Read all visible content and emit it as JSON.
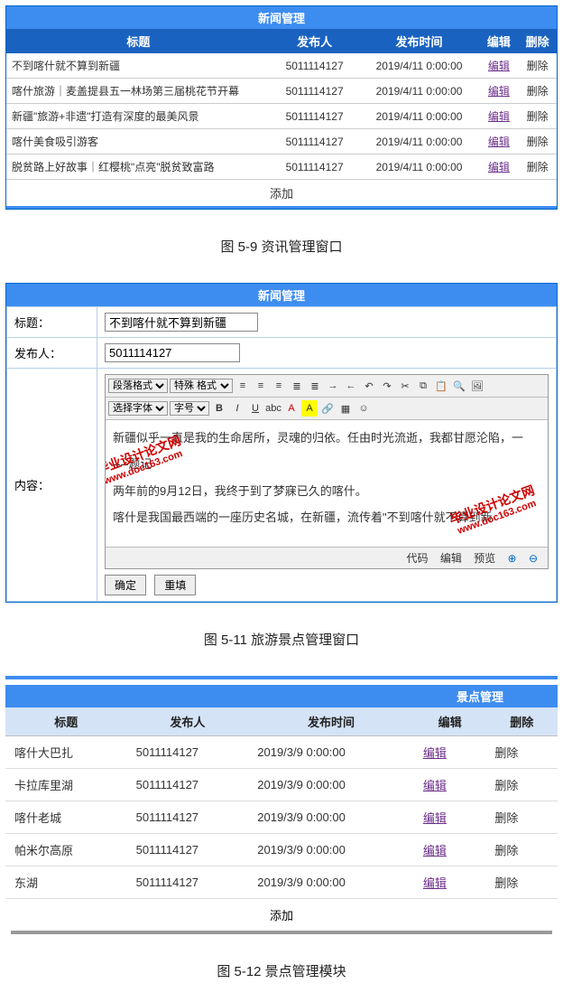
{
  "panel1": {
    "title": "新闻管理",
    "headers": {
      "title": "标题",
      "publisher": "发布人",
      "time": "发布时间",
      "edit": "编辑",
      "del": "删除"
    },
    "rows": [
      {
        "title": "不到喀什就不算到新疆",
        "publisher": "5011114127",
        "time": "2019/4/11 0:00:00",
        "edit": "编辑",
        "del": "删除"
      },
      {
        "title": "喀什旅游｜麦盖提县五一林场第三届桃花节开幕",
        "publisher": "5011114127",
        "time": "2019/4/11 0:00:00",
        "edit": "编辑",
        "del": "删除"
      },
      {
        "title": "新疆\"旅游+非遗\"打造有深度的最美风景",
        "publisher": "5011114127",
        "time": "2019/4/11 0:00:00",
        "edit": "编辑",
        "del": "删除"
      },
      {
        "title": "喀什美食吸引游客",
        "publisher": "5011114127",
        "time": "2019/4/11 0:00:00",
        "edit": "编辑",
        "del": "删除"
      },
      {
        "title": "脱贫路上好故事｜红樱桃\"点亮\"脱贫致富路",
        "publisher": "5011114127",
        "time": "2019/4/11 0:00:00",
        "edit": "编辑",
        "del": "删除"
      }
    ],
    "add": "添加"
  },
  "caption1": "图 5-9 资讯管理窗口",
  "form": {
    "panel_title": "新闻管理",
    "title_label": "标题：",
    "title_value": "不到喀什就不算到新疆",
    "publisher_label": "发布人：",
    "publisher_value": "5011114127",
    "content_label": "内容：",
    "toolbar": {
      "para": "段落格式",
      "special": "特殊     格式",
      "font": "选择字体",
      "size": "字号"
    },
    "body_lines": [
      "新疆似乎一直是我的生命居所，灵魂的归依。任由时光流逝，我都甘愿沦陷，一",
      "----题记",
      "两年前的9月12日，我终于到了梦寐已久的喀什。",
      "喀什是我国最西端的一座历史名城，在新疆，流传着\"不到喀什就不算到新"
    ],
    "footer": {
      "code": "代码",
      "edit": "编辑",
      "preview": "预览"
    },
    "buttons": {
      "ok": "确定",
      "reset": "重填"
    },
    "watermark": {
      "big": "毕业设计论文网",
      "small": "www.doc163.com"
    }
  },
  "caption2": "图 5-11 旅游景点管理窗口",
  "panel2": {
    "title": "景点管理",
    "headers": {
      "title": "标题",
      "publisher": "发布人",
      "time": "发布时间",
      "edit": "编辑",
      "del": "删除"
    },
    "rows": [
      {
        "title": "喀什大巴扎",
        "publisher": "5011114127",
        "time": "2019/3/9 0:00:00",
        "edit": "编辑",
        "del": "删除"
      },
      {
        "title": "卡拉库里湖",
        "publisher": "5011114127",
        "time": "2019/3/9 0:00:00",
        "edit": "编辑",
        "del": "删除"
      },
      {
        "title": "喀什老城",
        "publisher": "5011114127",
        "time": "2019/3/9 0:00:00",
        "edit": "编辑",
        "del": "删除"
      },
      {
        "title": "帕米尔高原",
        "publisher": "5011114127",
        "time": "2019/3/9 0:00:00",
        "edit": "编辑",
        "del": "删除"
      },
      {
        "title": "东湖",
        "publisher": "5011114127",
        "time": "2019/3/9 0:00:00",
        "edit": "编辑",
        "del": "删除"
      }
    ],
    "add": "添加"
  },
  "caption3": "图 5-12 景点管理模块"
}
